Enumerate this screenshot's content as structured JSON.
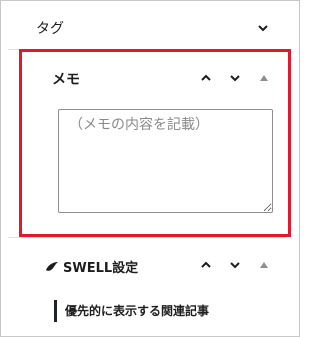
{
  "tag_panel": {
    "title": "タグ",
    "toggle_icon": "chevron-down-icon"
  },
  "memo_panel": {
    "title": "メモ",
    "textarea_placeholder": "（メモの内容を記載）",
    "textarea_value": "",
    "controls": [
      "chevron-up-icon",
      "chevron-down-icon",
      "caret-up-icon"
    ]
  },
  "swell_panel": {
    "title": "SWELL設定",
    "logo_icon": "swell-logo-icon",
    "controls": [
      "chevron-up-icon",
      "chevron-down-icon",
      "caret-up-icon"
    ],
    "section_label": "優先的に表示する関連記事"
  },
  "highlight_color": "#e1192a"
}
